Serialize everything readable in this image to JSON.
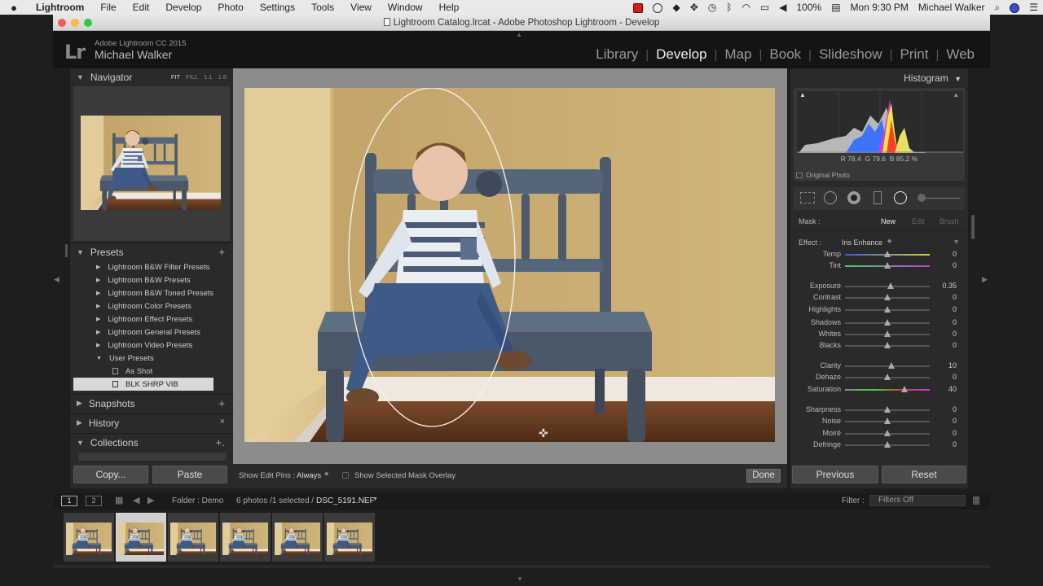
{
  "menubar": {
    "apple": "",
    "items": [
      "Lightroom",
      "File",
      "Edit",
      "Develop",
      "Photo",
      "Settings",
      "Tools",
      "View",
      "Window",
      "Help"
    ],
    "battery": "100%",
    "clock": "Mon 9:30 PM",
    "user": "Michael Walker"
  },
  "window": {
    "title": "Lightroom Catalog.lrcat - Adobe Photoshop Lightroom - Develop"
  },
  "identity": {
    "logo": "Lr",
    "version": "Adobe Lightroom CC 2015",
    "user": "Michael Walker"
  },
  "modules": [
    "Library",
    "Develop",
    "Map",
    "Book",
    "Slideshow",
    "Print",
    "Web"
  ],
  "navigator": {
    "title": "Navigator",
    "options": [
      "FIT",
      "FILL",
      "1:1",
      "1:8"
    ]
  },
  "presets": {
    "title": "Presets",
    "items": [
      "Lightroom B&W Filter Presets",
      "Lightroom B&W Presets",
      "Lightroom B&W Toned Presets",
      "Lightroom Color Presets",
      "Lightroom Effect Presets",
      "Lightroom General Presets",
      "Lightroom Video Presets",
      "User Presets"
    ],
    "user_presets": [
      "As Shot",
      "BLK SHRP VIB"
    ]
  },
  "panels": {
    "snapshots": "Snapshots",
    "history": "History",
    "collections": "Collections"
  },
  "left_buttons": {
    "copy": "Copy...",
    "paste": "Paste"
  },
  "toolbar": {
    "show_pins_label": "Show Edit Pins :",
    "show_pins_value": "Always",
    "overlay_label": "Show Selected Mask Overlay",
    "done": "Done"
  },
  "histogram": {
    "title": "Histogram",
    "r_label": "R",
    "r": "78.4",
    "g_label": "G",
    "g": "79.6",
    "b_label": "B",
    "b": "85.2",
    "unit": "%",
    "original_photo": "Original Photo"
  },
  "mask": {
    "label": "Mask :",
    "new": "New",
    "edit": "Edit",
    "brush": "Brush"
  },
  "effect": {
    "label": "Effect :",
    "value": "Iris Enhance"
  },
  "sliders": [
    {
      "label": "Temp",
      "value": "0",
      "pos": 0.5
    },
    {
      "label": "Tint",
      "value": "0",
      "pos": 0.5
    },
    {
      "label": "Exposure",
      "value": "0.35",
      "pos": 0.54
    },
    {
      "label": "Contrast",
      "value": "0",
      "pos": 0.5
    },
    {
      "label": "Highlights",
      "value": "0",
      "pos": 0.5
    },
    {
      "label": "Shadows",
      "value": "0",
      "pos": 0.5
    },
    {
      "label": "Whites",
      "value": "0",
      "pos": 0.5
    },
    {
      "label": "Blacks",
      "value": "0",
      "pos": 0.5
    },
    {
      "label": "Clarity",
      "value": "10",
      "pos": 0.55
    },
    {
      "label": "Dehaze",
      "value": "0",
      "pos": 0.5
    },
    {
      "label": "Saturation",
      "value": "40",
      "pos": 0.7
    },
    {
      "label": "Sharpness",
      "value": "0",
      "pos": 0.5
    },
    {
      "label": "Noise",
      "value": "0",
      "pos": 0.5
    },
    {
      "label": "Moiré",
      "value": "0",
      "pos": 0.5
    },
    {
      "label": "Defringe",
      "value": "0",
      "pos": 0.5
    }
  ],
  "right_buttons": {
    "previous": "Previous",
    "reset": "Reset"
  },
  "filmbar": {
    "view1": "1",
    "view2": "2",
    "folder": "Folder : Demo",
    "count": "6 photos /1 selected /",
    "filename": "DSC_5191.NEF",
    "filter_label": "Filter :",
    "filter_value": "Filters Off"
  },
  "colors": {
    "wall": "#c9ae74",
    "floor": "#6e3f24",
    "bench": "#4f5d6e"
  }
}
